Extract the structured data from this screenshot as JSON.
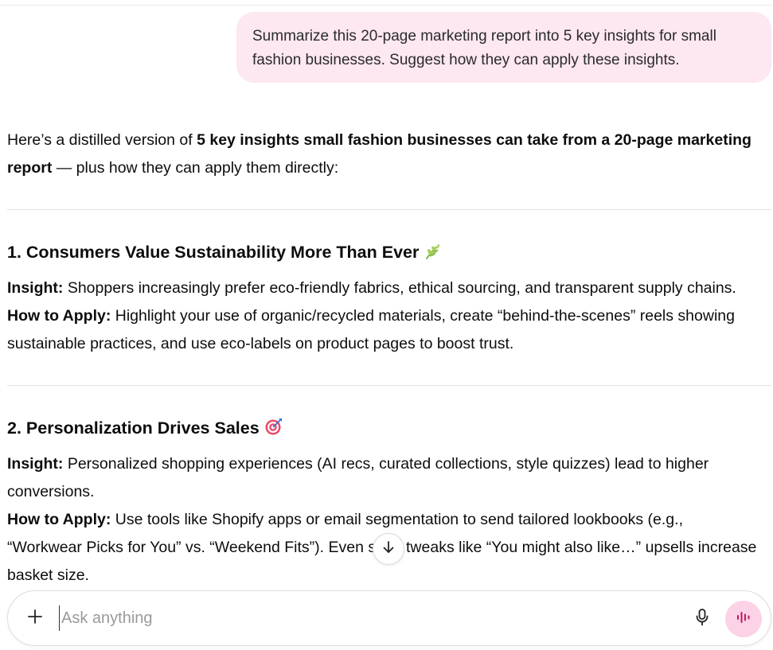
{
  "user_message": {
    "line1": "Summarize this 20-page marketing report into 5 key insights for small",
    "line2": "fashion businesses. Suggest how they can apply these insights."
  },
  "response": {
    "intro_line1_prefix": "Here’s a distilled version of ",
    "intro_line1_bold": "5 key insights small fashion businesses can take from a 20-page marketing",
    "intro_line2_bold": "report",
    "intro_line2_suffix": " — plus how they can apply them directly:",
    "sections": [
      {
        "heading": "1. Consumers Value Sustainability More Than Ever",
        "emoji": "herb-icon",
        "insight_label": "Insight:",
        "insight_line1": " Shoppers increasingly prefer eco-friendly fabrics, ethical sourcing, and transparent supply chains.",
        "apply_label": "How to Apply:",
        "apply_line1": " Highlight your use of organic/recycled materials, create “behind-the-scenes” reels showing",
        "apply_line2": "sustainable practices, and use eco-labels on product pages to boost trust."
      },
      {
        "heading": "2. Personalization Drives Sales",
        "emoji": "direct-hit-icon",
        "insight_label": "Insight:",
        "insight_line1": " Personalized shopping experiences (AI recs, curated collections, style quizzes) lead to higher",
        "insight_line2": "conversions.",
        "apply_label": "How to Apply:",
        "apply_line1": " Use tools like Shopify apps or email segmentation to send tailored lookbooks (e.g.,",
        "apply_line2_a": "“Workwear Picks for You” vs. “Weekend Fits”). Even sı",
        "apply_line2_b": "tweaks like “You might also like…” upsells increase",
        "apply_line3": "basket size."
      }
    ]
  },
  "composer": {
    "placeholder": "Ask anything",
    "value": ""
  },
  "colors": {
    "user_bubble": "#fde7f1",
    "voice_button": "#fbd2e6"
  }
}
